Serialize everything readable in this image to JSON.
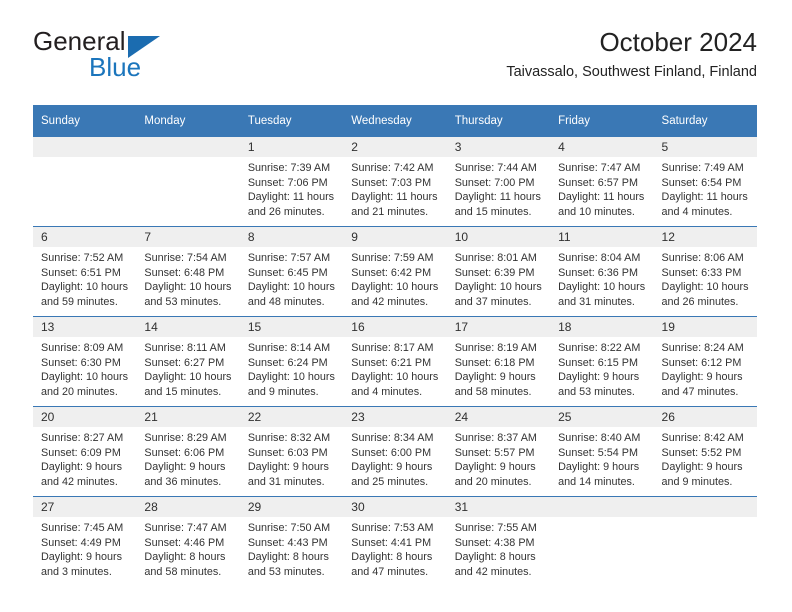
{
  "logo": {
    "word_top": "General",
    "word_bottom": "Blue",
    "triangle_color": "#1b6cb0",
    "blue_color": "#1b75bc"
  },
  "header": {
    "title": "October 2024",
    "subtitle": "Taivassalo, Southwest Finland, Finland"
  },
  "theme": {
    "header_blue": "#3a78b5",
    "daynum_band": "#efefef",
    "text": "#333333"
  },
  "weekday_headers": [
    "Sunday",
    "Monday",
    "Tuesday",
    "Wednesday",
    "Thursday",
    "Friday",
    "Saturday"
  ],
  "weeks": [
    [
      {
        "day": "",
        "lines": []
      },
      {
        "day": "",
        "lines": []
      },
      {
        "day": "1",
        "lines": [
          "Sunrise: 7:39 AM",
          "Sunset: 7:06 PM",
          "Daylight: 11 hours",
          "and 26 minutes."
        ]
      },
      {
        "day": "2",
        "lines": [
          "Sunrise: 7:42 AM",
          "Sunset: 7:03 PM",
          "Daylight: 11 hours",
          "and 21 minutes."
        ]
      },
      {
        "day": "3",
        "lines": [
          "Sunrise: 7:44 AM",
          "Sunset: 7:00 PM",
          "Daylight: 11 hours",
          "and 15 minutes."
        ]
      },
      {
        "day": "4",
        "lines": [
          "Sunrise: 7:47 AM",
          "Sunset: 6:57 PM",
          "Daylight: 11 hours",
          "and 10 minutes."
        ]
      },
      {
        "day": "5",
        "lines": [
          "Sunrise: 7:49 AM",
          "Sunset: 6:54 PM",
          "Daylight: 11 hours",
          "and 4 minutes."
        ]
      }
    ],
    [
      {
        "day": "6",
        "lines": [
          "Sunrise: 7:52 AM",
          "Sunset: 6:51 PM",
          "Daylight: 10 hours",
          "and 59 minutes."
        ]
      },
      {
        "day": "7",
        "lines": [
          "Sunrise: 7:54 AM",
          "Sunset: 6:48 PM",
          "Daylight: 10 hours",
          "and 53 minutes."
        ]
      },
      {
        "day": "8",
        "lines": [
          "Sunrise: 7:57 AM",
          "Sunset: 6:45 PM",
          "Daylight: 10 hours",
          "and 48 minutes."
        ]
      },
      {
        "day": "9",
        "lines": [
          "Sunrise: 7:59 AM",
          "Sunset: 6:42 PM",
          "Daylight: 10 hours",
          "and 42 minutes."
        ]
      },
      {
        "day": "10",
        "lines": [
          "Sunrise: 8:01 AM",
          "Sunset: 6:39 PM",
          "Daylight: 10 hours",
          "and 37 minutes."
        ]
      },
      {
        "day": "11",
        "lines": [
          "Sunrise: 8:04 AM",
          "Sunset: 6:36 PM",
          "Daylight: 10 hours",
          "and 31 minutes."
        ]
      },
      {
        "day": "12",
        "lines": [
          "Sunrise: 8:06 AM",
          "Sunset: 6:33 PM",
          "Daylight: 10 hours",
          "and 26 minutes."
        ]
      }
    ],
    [
      {
        "day": "13",
        "lines": [
          "Sunrise: 8:09 AM",
          "Sunset: 6:30 PM",
          "Daylight: 10 hours",
          "and 20 minutes."
        ]
      },
      {
        "day": "14",
        "lines": [
          "Sunrise: 8:11 AM",
          "Sunset: 6:27 PM",
          "Daylight: 10 hours",
          "and 15 minutes."
        ]
      },
      {
        "day": "15",
        "lines": [
          "Sunrise: 8:14 AM",
          "Sunset: 6:24 PM",
          "Daylight: 10 hours",
          "and 9 minutes."
        ]
      },
      {
        "day": "16",
        "lines": [
          "Sunrise: 8:17 AM",
          "Sunset: 6:21 PM",
          "Daylight: 10 hours",
          "and 4 minutes."
        ]
      },
      {
        "day": "17",
        "lines": [
          "Sunrise: 8:19 AM",
          "Sunset: 6:18 PM",
          "Daylight: 9 hours",
          "and 58 minutes."
        ]
      },
      {
        "day": "18",
        "lines": [
          "Sunrise: 8:22 AM",
          "Sunset: 6:15 PM",
          "Daylight: 9 hours",
          "and 53 minutes."
        ]
      },
      {
        "day": "19",
        "lines": [
          "Sunrise: 8:24 AM",
          "Sunset: 6:12 PM",
          "Daylight: 9 hours",
          "and 47 minutes."
        ]
      }
    ],
    [
      {
        "day": "20",
        "lines": [
          "Sunrise: 8:27 AM",
          "Sunset: 6:09 PM",
          "Daylight: 9 hours",
          "and 42 minutes."
        ]
      },
      {
        "day": "21",
        "lines": [
          "Sunrise: 8:29 AM",
          "Sunset: 6:06 PM",
          "Daylight: 9 hours",
          "and 36 minutes."
        ]
      },
      {
        "day": "22",
        "lines": [
          "Sunrise: 8:32 AM",
          "Sunset: 6:03 PM",
          "Daylight: 9 hours",
          "and 31 minutes."
        ]
      },
      {
        "day": "23",
        "lines": [
          "Sunrise: 8:34 AM",
          "Sunset: 6:00 PM",
          "Daylight: 9 hours",
          "and 25 minutes."
        ]
      },
      {
        "day": "24",
        "lines": [
          "Sunrise: 8:37 AM",
          "Sunset: 5:57 PM",
          "Daylight: 9 hours",
          "and 20 minutes."
        ]
      },
      {
        "day": "25",
        "lines": [
          "Sunrise: 8:40 AM",
          "Sunset: 5:54 PM",
          "Daylight: 9 hours",
          "and 14 minutes."
        ]
      },
      {
        "day": "26",
        "lines": [
          "Sunrise: 8:42 AM",
          "Sunset: 5:52 PM",
          "Daylight: 9 hours",
          "and 9 minutes."
        ]
      }
    ],
    [
      {
        "day": "27",
        "lines": [
          "Sunrise: 7:45 AM",
          "Sunset: 4:49 PM",
          "Daylight: 9 hours",
          "and 3 minutes."
        ]
      },
      {
        "day": "28",
        "lines": [
          "Sunrise: 7:47 AM",
          "Sunset: 4:46 PM",
          "Daylight: 8 hours",
          "and 58 minutes."
        ]
      },
      {
        "day": "29",
        "lines": [
          "Sunrise: 7:50 AM",
          "Sunset: 4:43 PM",
          "Daylight: 8 hours",
          "and 53 minutes."
        ]
      },
      {
        "day": "30",
        "lines": [
          "Sunrise: 7:53 AM",
          "Sunset: 4:41 PM",
          "Daylight: 8 hours",
          "and 47 minutes."
        ]
      },
      {
        "day": "31",
        "lines": [
          "Sunrise: 7:55 AM",
          "Sunset: 4:38 PM",
          "Daylight: 8 hours",
          "and 42 minutes."
        ]
      },
      {
        "day": "",
        "lines": []
      },
      {
        "day": "",
        "lines": []
      }
    ]
  ]
}
